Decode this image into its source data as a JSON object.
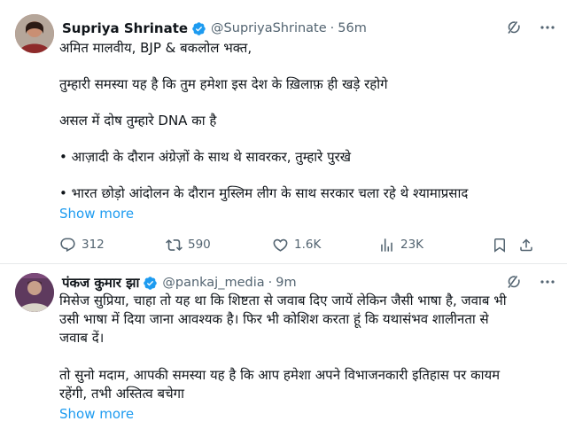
{
  "tweets": [
    {
      "author_name": "Supriya Shrinate",
      "handle": "@SupriyaShrinate",
      "separator": "·",
      "time": "56m",
      "lines": [
        "अमित मालवीय, BJP & बकलोल भक्त,",
        "",
        "तुम्हारी समस्या यह है कि तुम हमेशा इस देश के ख़िलाफ़ ही खड़े रहोगे",
        "",
        "असल में दोष तुम्हारे DNA का है",
        "",
        "• आज़ादी के दौरान अंग्रेज़ों के साथ थे सावरकर, तुम्हारे पुरखे",
        "",
        "• भारत छोड़ो आंदोलन के दौरान मुस्लिम लीग के साथ सरकार चला रहे थे श्यामाप्रसाद"
      ],
      "show_more": "Show more",
      "stats": {
        "replies": "312",
        "retweets": "590",
        "likes": "1.6K",
        "views": "23K"
      }
    },
    {
      "author_name": "पंकज कुमार झा",
      "handle": "@pankaj_media",
      "separator": "·",
      "time": "9m",
      "lines": [
        "मिसेज सुप्रिया, चाहा तो यह था कि शिष्टता से जवाब दिए जायें लेकिन जैसी भाषा है, जवाब भी",
        "उसी भाषा में दिया जाना आवश्यक है। फिर भी कोशिश करता हूं कि यथासंभव शालीनता से",
        "जवाब दें।",
        "",
        "तो सुनो मदाम, आपकी समस्या यह है कि आप हमेशा अपने विभाजनकारी इतिहास पर कायम",
        "रहेंगी, तभी अस्तित्व बचेगा"
      ],
      "show_more": "Show more"
    }
  ],
  "colors": {
    "link": "#1d9bf0",
    "secondary_text": "#536471",
    "verified": "#1d9bf0",
    "divider": "#e7e9ea"
  },
  "icons": {
    "reply": "reply-icon",
    "retweet": "retweet-icon",
    "like": "like-icon",
    "views": "views-icon",
    "bookmark": "bookmark-icon",
    "share": "share-icon",
    "grok": "grok-icon",
    "more": "more-icon",
    "verified": "verified-badge-icon"
  }
}
